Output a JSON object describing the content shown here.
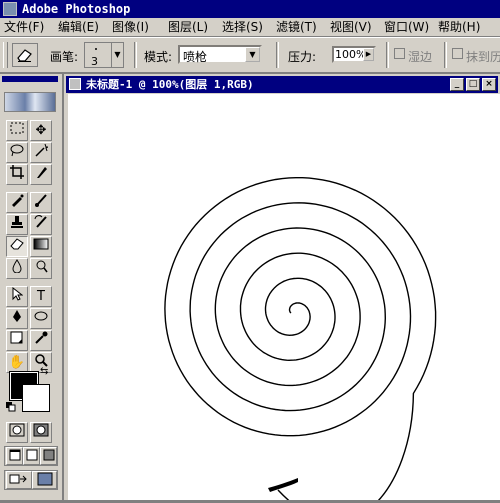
{
  "app": {
    "title": "Adobe Photoshop"
  },
  "menu": [
    "文件(F)",
    "编辑(E)",
    "图像(I)",
    "图层(L)",
    "选择(S)",
    "滤镜(T)",
    "视图(V)",
    "窗口(W)",
    "帮助(H)"
  ],
  "options": {
    "brush_label": "画笔:",
    "brush_size": "3",
    "mode_label": "模式:",
    "mode_value": "喷枪",
    "pressure_label": "压力:",
    "pressure_value": "100%",
    "wet_edges_label": "湿边",
    "erase_history_label": "抹到历"
  },
  "document": {
    "title": "未标题-1 @ 100%(图层 1,RGB)"
  },
  "colors": {
    "title_bar": "#000080",
    "chrome": "#d4d0c8",
    "foreground": "#000000",
    "background": "#ffffff"
  },
  "tools": [
    "marquee",
    "move",
    "lasso",
    "magic-wand",
    "crop",
    "slice",
    "airbrush",
    "paintbrush",
    "clone-stamp",
    "history-brush",
    "eraser",
    "gradient",
    "blur",
    "dodge",
    "path-select",
    "type",
    "pen",
    "ellipse",
    "notes",
    "eyedropper",
    "hand",
    "zoom"
  ]
}
